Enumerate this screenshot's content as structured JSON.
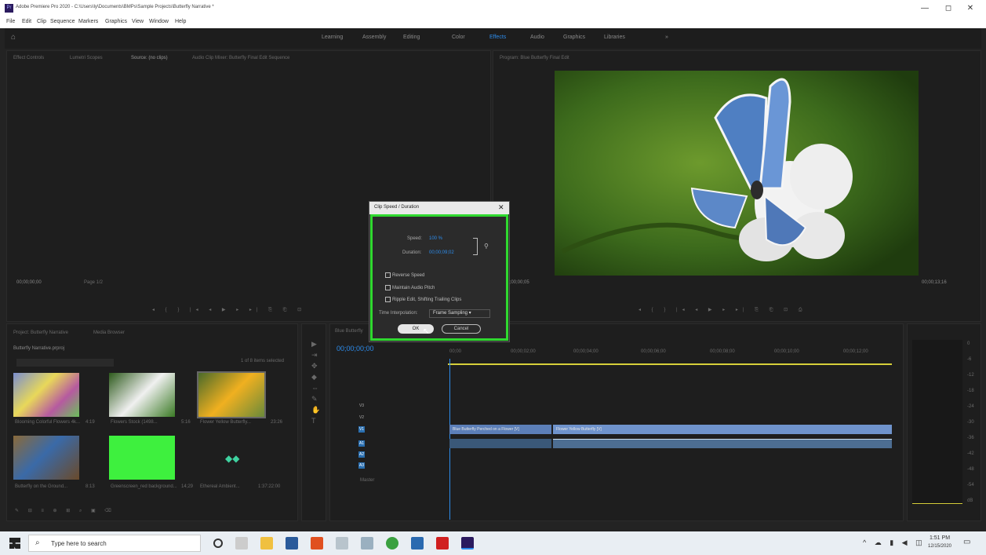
{
  "window": {
    "app_icon": "Pr",
    "title": "Adobe Premiere Pro 2020 - C:\\Users\\ly\\Documents\\BMPs\\Sample Projects\\Butterfly Narrative *",
    "minimize": "—",
    "maximize": "◻",
    "close": "✕"
  },
  "menu": [
    "File",
    "Edit",
    "Clip",
    "Sequence",
    "Markers",
    "Graphics",
    "View",
    "Window",
    "Help"
  ],
  "workspaces": [
    "Learning",
    "Assembly",
    "Editing",
    "Color",
    "Effects",
    "Audio",
    "Graphics",
    "Libraries"
  ],
  "active_workspace": "Effects",
  "source_monitor": {
    "tabs": [
      "Effect Controls",
      "Lumetri Scopes",
      "Source: (no clips)",
      "Audio Clip Mixer: Butterfly Final Edit Sequence"
    ],
    "timecode": "00;00;00;00",
    "fit": "Page 1/2"
  },
  "program_monitor": {
    "tab": "Program: Blue Butterfly Final Edit",
    "timecode_left": "00;00;00;05",
    "timecode_right": "00;00;13;16"
  },
  "dialog": {
    "title": "Clip Speed / Duration",
    "speed_label": "Speed:",
    "speed_value": "100 %",
    "duration_label": "Duration:",
    "duration_value": "00;00;09;02",
    "reverse": "Reverse Speed",
    "maintain": "Maintain Audio Pitch",
    "ripple": "Ripple Edit, Shifting Trailing Clips",
    "interp_label": "Time Interpolation:",
    "interp_value": "Frame Sampling",
    "ok": "OK",
    "cancel": "Cancel"
  },
  "project": {
    "tabs": [
      "Project: Butterfly Narrative",
      "Media Browser"
    ],
    "bin": "Butterfly Narrative.prproj",
    "selected": "1 of 8 items selected",
    "items": [
      {
        "label": "Blooming Colorful Flowers 4k...",
        "dur": "4:19"
      },
      {
        "label": "Flowers Stock (1498...",
        "dur": "5:16"
      },
      {
        "label": "Flower Yellow Butterfly...",
        "dur": "23:26"
      },
      {
        "label": "Butterfly on the Ground...",
        "dur": "8:13"
      },
      {
        "label": "Greenscreen_red background...",
        "dur": "14;29"
      },
      {
        "label": "Ethereal Ambient...",
        "dur": "1:37:22:00"
      }
    ]
  },
  "timeline": {
    "tab": "Blue Butterfly",
    "timecode": "00;00;00;00",
    "ruler": [
      "00;00",
      "00;00;02;00",
      "00;00;04;00",
      "00;00;06;00",
      "00;00;08;00",
      "00;00;10;00",
      "00;00;12;00"
    ],
    "v_tracks": [
      "V3",
      "V2",
      "V1"
    ],
    "a_tracks": [
      "A1",
      "A2",
      "A3"
    ],
    "clip_v1a": "Blue Butterfly Perched on a Flower [V]",
    "clip_v1b": "Flower Yellow Butterfly [V]",
    "master": "Master"
  },
  "meter_ticks": [
    "0",
    "-6",
    "-12",
    "-18",
    "-24",
    "-30",
    "-36",
    "-42",
    "-48",
    "-54",
    "dB"
  ],
  "taskbar": {
    "search": "Type here to search",
    "time": "1:51 PM",
    "date": "12/15/2020"
  }
}
